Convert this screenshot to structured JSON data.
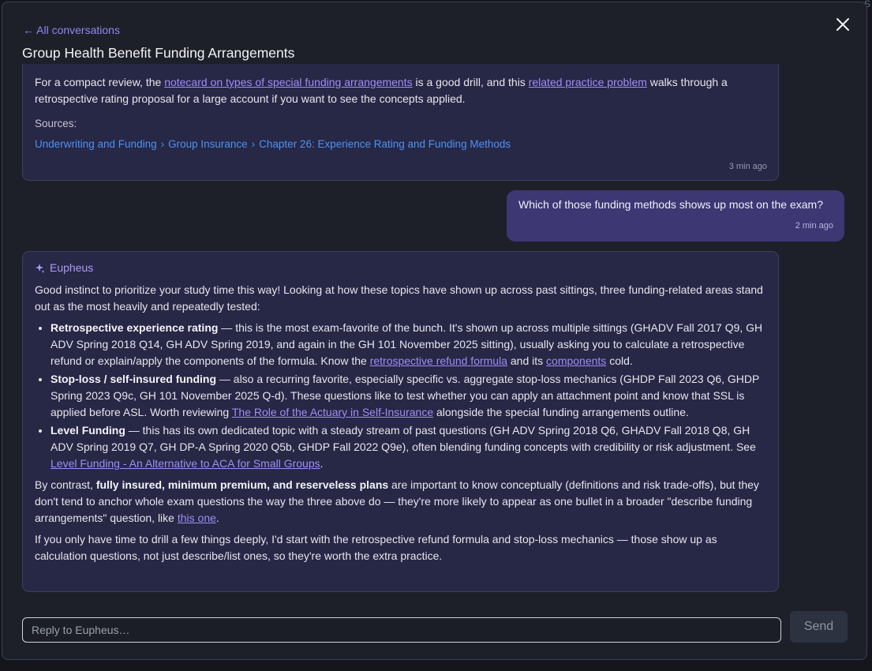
{
  "background": {
    "corner_glyph": "S"
  },
  "header": {
    "back_link": "← All conversations",
    "title": "Group Health Benefit Funding Arrangements",
    "close_icon": "close-icon"
  },
  "previous_message": {
    "text_1": "For a compact review, the ",
    "link_1": "notecard on types of special funding arrangements",
    "text_2": " is a good drill, and this ",
    "link_2": "related practice problem",
    "text_3": " walks through a retrospective rating proposal for a large account if you want to see the concepts applied.",
    "sources_label": "Sources:",
    "sources_path": [
      "Underwriting and Funding",
      "Group Insurance",
      "Chapter 26: Experience Rating and Funding Methods"
    ],
    "timestamp": "3 min ago"
  },
  "user_message": {
    "text": "Which of those funding methods shows up most on the exam?",
    "timestamp": "2 min ago"
  },
  "assistant_message": {
    "name": "Eupheus",
    "icon": "sparkle-icon",
    "intro": "Good instinct to prioritize your study time this way! Looking at how these topics have shown up across past sittings, three funding-related areas stand out as the most heavily and repeatedly tested:",
    "bullets": [
      {
        "title": "Retrospective experience rating",
        "text_1": " — this is the most exam-favorite of the bunch. It's shown up across multiple sittings (GHADV Fall 2017 Q9, GH ADV Spring 2018 Q14, GH ADV Spring 2019, and again in the GH 101 November 2025 sitting), usually asking you to calculate a retrospective refund or explain/apply the components of the formula. Know the ",
        "link_1": "retrospective refund formula",
        "text_2": " and its ",
        "link_2": "components",
        "text_3": " cold."
      },
      {
        "title": "Stop-loss / self-insured funding",
        "text_1": " — also a recurring favorite, especially specific vs. aggregate stop-loss mechanics (GHDP Fall 2023 Q6, GHDP Spring 2023 Q9c, GH 101 November 2025 Q-d). These questions like to test whether you can apply an attachment point and know that SSL is applied before ASL. Worth reviewing ",
        "link_1": "The Role of the Actuary in Self-Insurance",
        "text_2": " alongside the special funding arrangements outline."
      },
      {
        "title": "Level Funding",
        "text_1": " — this has its own dedicated topic with a steady stream of past questions (GH ADV Spring 2018 Q6, GHADV Fall 2018 Q8, GH ADV Spring 2019 Q7, GH DP-A Spring 2020 Q5b, GHDP Fall 2022 Q9e), often blending funding concepts with credibility or risk adjustment. See ",
        "link_1": "Level Funding - An Alternative to ACA for Small Groups",
        "text_2": "."
      }
    ],
    "contrast_text_1": "By contrast, ",
    "contrast_bold": "fully insured, minimum premium, and reserveless plans",
    "contrast_text_2": " are important to know conceptually (definitions and risk trade-offs), but they don't tend to anchor whole exam questions the way the three above do — they're more likely to appear as one bullet in a broader \"describe funding arrangements\" question, like ",
    "contrast_link": "this one",
    "contrast_text_3": ".",
    "closing": "If you only have time to drill a few things deeply, I'd start with the retrospective refund formula and stop-loss mechanics — those show up as calculation questions, not just describe/list ones, so they're worth the extra practice."
  },
  "composer": {
    "placeholder": "Reply to Eupheus…",
    "send_label": "Send"
  }
}
